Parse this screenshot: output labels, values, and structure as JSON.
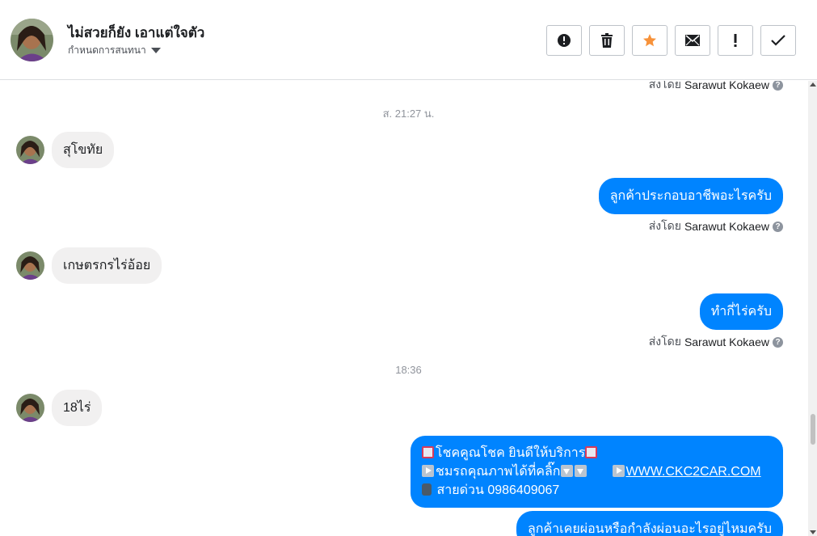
{
  "header": {
    "contact_name": "ไม่สวยก็ยัง เอาแต่ใจตัว",
    "assign_label": "กำหนดการสนทนา",
    "toolbar": [
      {
        "name": "spam-button",
        "icon": "alert-circle-icon"
      },
      {
        "name": "delete-button",
        "icon": "trash-icon"
      },
      {
        "name": "star-button",
        "icon": "star-icon",
        "color": "#f7923a"
      },
      {
        "name": "mark-unread-button",
        "icon": "envelope-icon"
      },
      {
        "name": "follow-up-button",
        "icon": "exclamation-icon"
      },
      {
        "name": "mark-done-button",
        "icon": "checkmark-icon"
      }
    ]
  },
  "sent_by_prefix": "ส่งโดย",
  "sent_by_name": "Sarawut Kokaew",
  "messages": {
    "top_sentby": "ส่งโดย Sarawut Kokaew",
    "ts1": "ส. 21:27 น.",
    "m1": "สุโขทัย",
    "m2": "ลูกค้าประกอบอาชีพอะไรครับ",
    "m3": "เกษตรกรไร่อ้อย",
    "m4": "ทำกี่ไร่ครับ",
    "ts2": "18:36",
    "m5": "18ไร่",
    "promo_line1": "โชคคูณโชค ยินดีให้บริการ",
    "promo_line2": "ชมรถคุณภาพได้ที่คลิ๊ก",
    "promo_link": "WWW.CKC2CAR.COM",
    "promo_line3": "สายด่วน 0986409067",
    "m7": "ลูกค้าเคยผ่อนหรือกำลังผ่อนอะไรอยู่ไหมครับ"
  },
  "colors": {
    "outgoing_bubble": "#0084ff",
    "incoming_bubble": "#f1f0f0",
    "star": "#f7923a"
  }
}
